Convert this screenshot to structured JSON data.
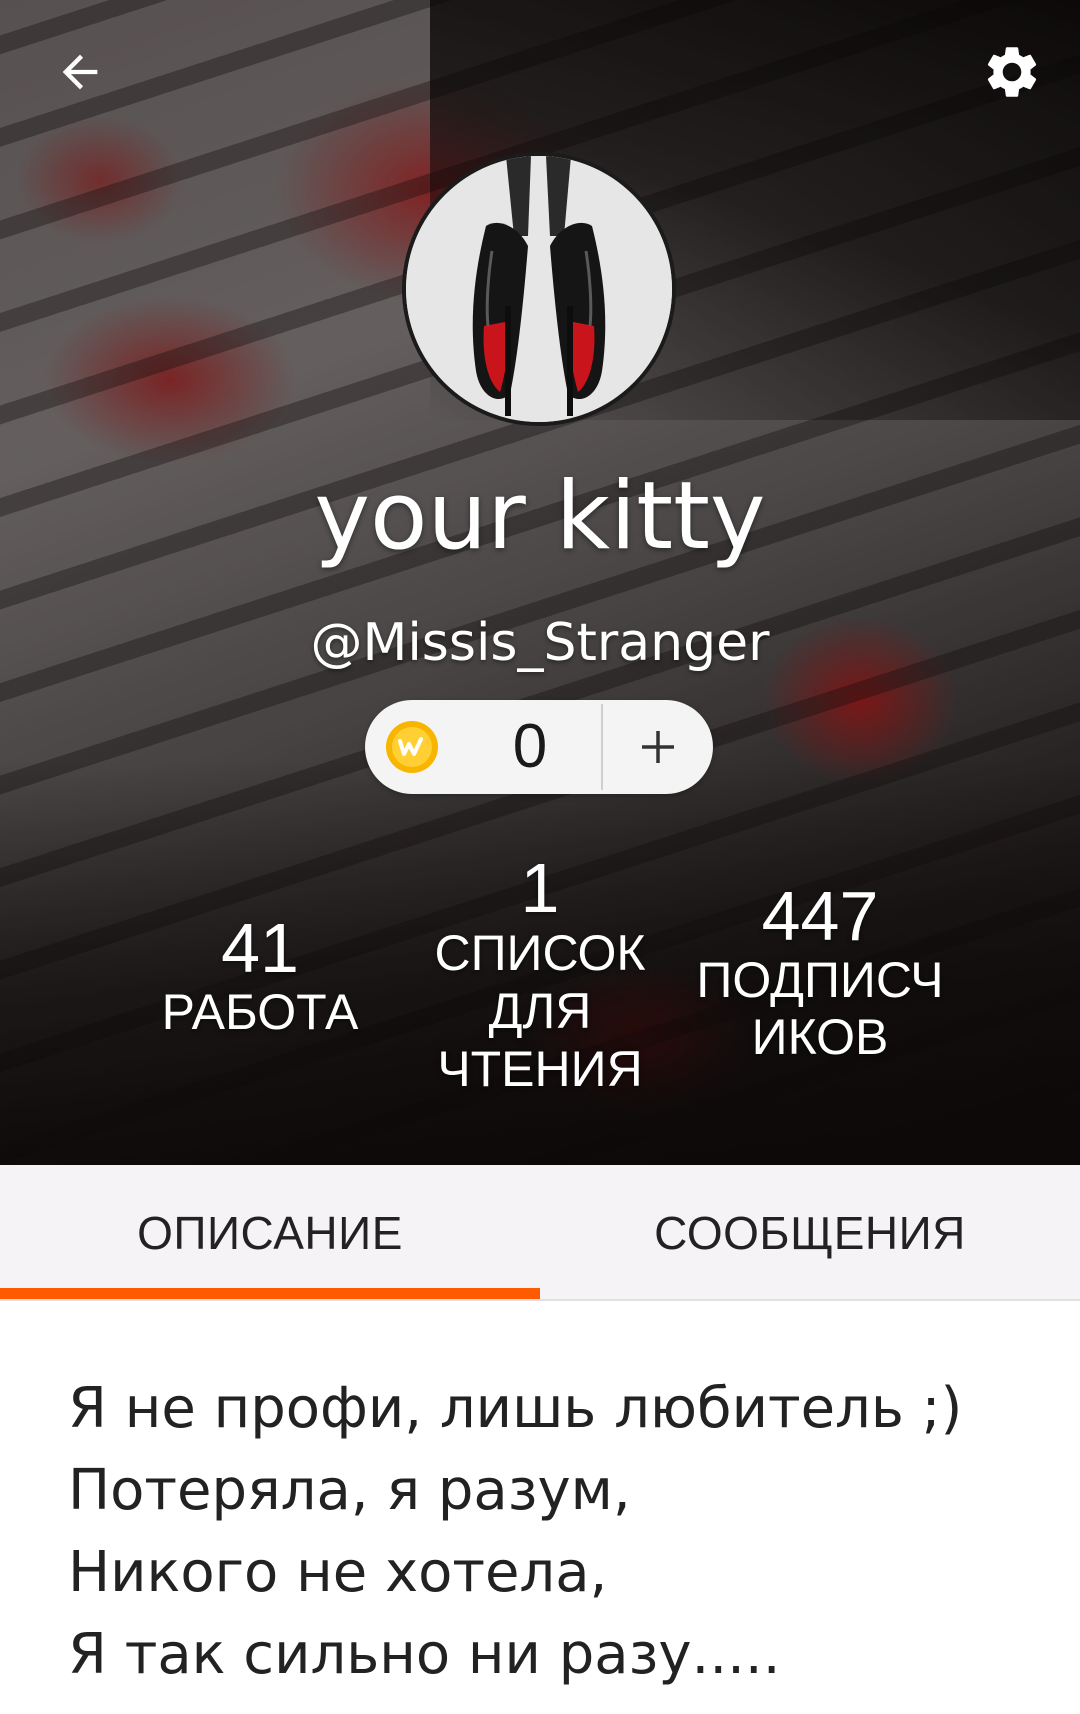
{
  "profile": {
    "display_name": "your kitty",
    "username": "@Missis_Stranger"
  },
  "coins": {
    "value": "0",
    "add_label": "+"
  },
  "stats": {
    "works": {
      "count": "41",
      "label": "РАБОТА"
    },
    "reading_lists": {
      "count": "1",
      "label_lines": [
        "СПИСОК",
        "ДЛЯ",
        "ЧТЕНИЯ"
      ]
    },
    "followers": {
      "count": "447",
      "label_lines": [
        "ПОДПИСЧ",
        "ИКОВ"
      ]
    }
  },
  "tabs": [
    {
      "label": "ОПИСАНИЕ",
      "active": true
    },
    {
      "label": "СООБЩЕНИЯ",
      "active": false
    }
  ],
  "description": [
    "Я не профи, лишь любитель ;)",
    "Потеряла, я разум,",
    "Никого не хотела,",
    "Я так сильно ни разу....."
  ],
  "icons": {
    "back": "arrow-left-icon",
    "settings": "gear-icon",
    "coin": "wattpad-coin-icon",
    "avatar": "red-sole-heels-photo"
  },
  "colors": {
    "accent": "#ff5a00",
    "coin": "#f7b500",
    "tab_bar_bg": "#f5f3f6"
  }
}
